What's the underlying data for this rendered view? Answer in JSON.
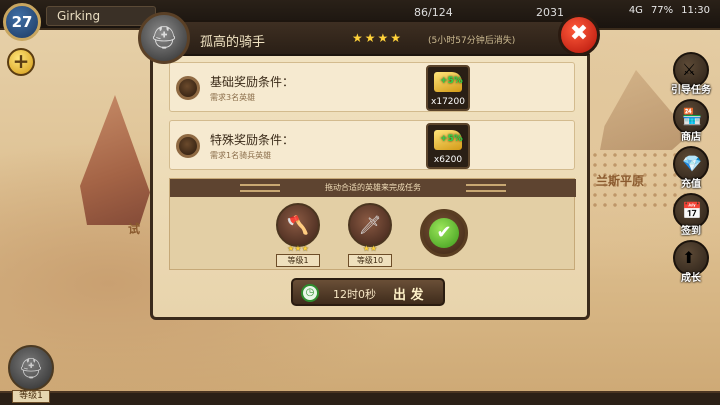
{
  "topbar": {
    "level": "27",
    "player_name": "Girking",
    "resource1": "86/124",
    "resource2": "2031",
    "status": {
      "signal": "4G",
      "battery": "77%",
      "time": "11:30"
    }
  },
  "map": {
    "plain_label": "兰斯平原",
    "trial_label": "试"
  },
  "side_menu": [
    {
      "label": "引导任务",
      "icon": "knight-icon"
    },
    {
      "label": "商店",
      "icon": "shop-icon"
    },
    {
      "label": "充值",
      "icon": "gem-icon"
    },
    {
      "label": "签到",
      "icon": "calendar-icon"
    },
    {
      "label": "成长",
      "icon": "growth-arrow-icon"
    }
  ],
  "hero_card": {
    "level": "等级1",
    "stars": "★★★"
  },
  "dialog": {
    "title": "孤高的骑手",
    "stars": "★★★★",
    "timer": "(5小时57分钟后消失)",
    "close": "✖",
    "conditions": [
      {
        "title": "基础奖励条件：",
        "sub": "需求3名英雄",
        "bonus": "+5%",
        "amount": "x17200"
      },
      {
        "title": "特殊奖励条件：",
        "sub": "需求1名骑兵英雄",
        "bonus": "+5%",
        "amount": "x6200"
      }
    ],
    "heroes_hint": "拖动合适的英雄来完成任务",
    "heroes": [
      {
        "stars": "★★★",
        "level": "等级1"
      },
      {
        "stars": "★★",
        "level": "等级10"
      }
    ],
    "go_button": {
      "time": "12时0秒",
      "label": "出 发"
    }
  }
}
